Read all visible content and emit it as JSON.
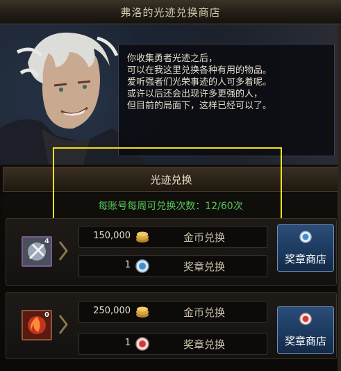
{
  "window": {
    "title": "弗洛的光迹兑换商店"
  },
  "npc": {
    "dialogue": [
      "你收集勇者光迹之后，",
      "可以在我这里兑换各种有用的物品。",
      "爱听强者们光荣事迹的人可多着呢。",
      "或许以后还会出现许多更强的人，",
      "但目前的局面下，这样已经可以了。"
    ]
  },
  "exchange": {
    "title": "光迹兑换",
    "quota_text": "每账号每周可兑换次数：12/60次"
  },
  "items": [
    {
      "icon": "silver-sword-icon",
      "count": "4",
      "gold_price": "150,000",
      "gold_label": "金币兑换",
      "medal_price": "1",
      "medal_label": "奖章兑换",
      "shop_label": "奖章商店"
    },
    {
      "icon": "red-flame-icon",
      "count": "0",
      "gold_price": "250,000",
      "gold_label": "金币兑换",
      "medal_price": "1",
      "medal_label": "奖章兑换",
      "shop_label": "奖章商店"
    }
  ],
  "colors": {
    "highlight": "#f2e11d",
    "quota_text": "#56c85a",
    "shop_button": "#1d3a60"
  }
}
